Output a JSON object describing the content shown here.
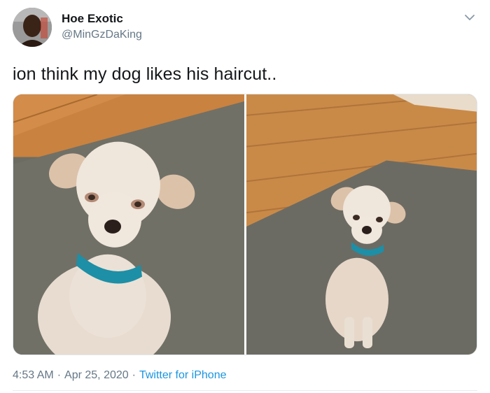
{
  "author": {
    "display_name": "Hoe Exotic",
    "handle": "@MinGzDaKing"
  },
  "tweet": {
    "text": "ion think my dog likes his haircut.."
  },
  "media": {
    "photos": [
      "dog-photo-closeup",
      "dog-photo-fullbody"
    ]
  },
  "meta": {
    "time": "4:53 AM",
    "separator": "·",
    "date": "Apr 25, 2020",
    "source": "Twitter for iPhone"
  },
  "icons": {
    "menu": "chevron-down-icon"
  },
  "colors": {
    "text_primary": "#14171a",
    "text_secondary": "#657786",
    "link": "#1b95e0"
  }
}
